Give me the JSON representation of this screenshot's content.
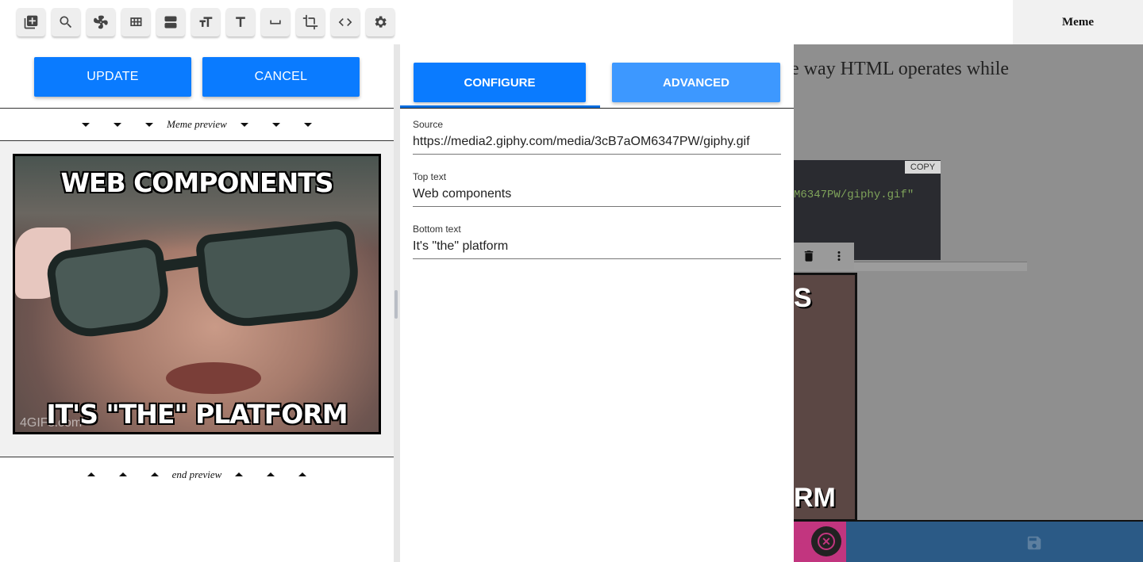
{
  "toolbar": {
    "tools": [
      {
        "name": "add-content-icon"
      },
      {
        "name": "search-icon"
      },
      {
        "name": "pinwheel-icon"
      },
      {
        "name": "layout-grid-icon"
      },
      {
        "name": "layout-rows-icon"
      },
      {
        "name": "text-size-icon"
      },
      {
        "name": "text-icon"
      },
      {
        "name": "space-bar-icon"
      },
      {
        "name": "crop-icon"
      },
      {
        "name": "code-icon"
      },
      {
        "name": "settings-icon"
      }
    ],
    "title": "Meme"
  },
  "preview_panel": {
    "update_label": "UPDATE",
    "cancel_label": "CANCEL",
    "header_label": "Meme preview",
    "footer_label": "end preview",
    "meme": {
      "top_text": "WEB COMPONENTS",
      "bottom_text": "IT'S \"THE\" PLATFORM",
      "watermark": "4GIFs.com"
    }
  },
  "config_panel": {
    "tabs": [
      {
        "label": "CONFIGURE",
        "active": true,
        "color": "#0a7bff"
      },
      {
        "label": "ADVANCED",
        "active": false,
        "color": "#3d98ff"
      }
    ],
    "fields": [
      {
        "label": "Source",
        "value": "https://media2.giphy.com/media/3cB7aOM6347PW/giphy.gif"
      },
      {
        "label": "Top text",
        "value": "Web components"
      },
      {
        "label": "Bottom text",
        "value": "It's \"the\" platform"
      }
    ]
  },
  "background_page": {
    "body_text": "e way HTML operates while",
    "copy_label": "COPY",
    "code_text": "M6347PW/giphy.gif\"",
    "meme_fragment_top": "S",
    "meme_fragment_bottom": "RM",
    "menu_glyph": "≡",
    "close_glyph": "✕"
  },
  "colors": {
    "accent": "#0a7bff",
    "accent_light": "#3d98ff",
    "bottom_bar": "#2b5a86",
    "pink": "#c2357f"
  }
}
